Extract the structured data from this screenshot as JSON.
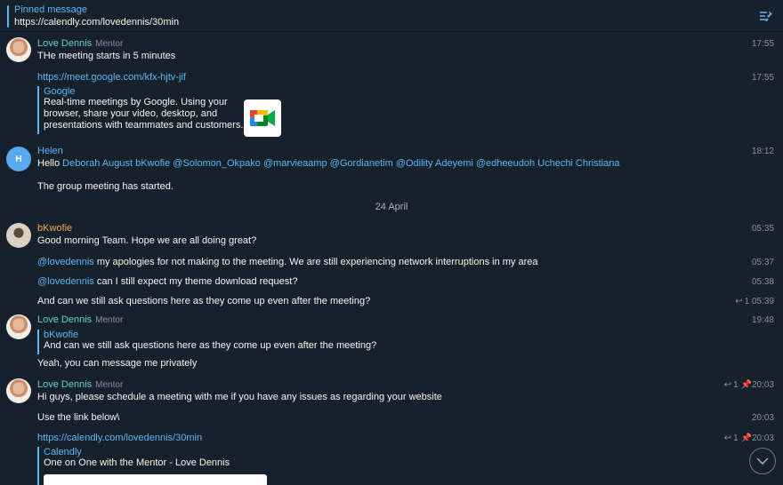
{
  "pinned": {
    "label": "Pinned message",
    "text": "https://calendly.com/lovedennis/30min"
  },
  "messages": {
    "m1": {
      "name": "Love Dennis",
      "role": "Mentor",
      "text": "THe meeting starts in 5 minutes",
      "time": "17:55"
    },
    "m2": {
      "text": "https://meet.google.com/kfx-hjtv-jif",
      "time": "17:55",
      "preview_title": "Google",
      "preview_lines": [
        "Real-time meetings by Google. Using your",
        "browser, share your video, desktop, and",
        "presentations with teammates and customers."
      ]
    },
    "m3": {
      "name": "Helen",
      "avatar_letter": "H",
      "time": "18:12",
      "prefix": "Hello",
      "mentions": "Deborah August bKwofie @Solomon_Okpako @marvieaamp @Gordianetim @Odility Adeyemi @edheeudoh Uchechi Christiana"
    },
    "m4": {
      "text": "The group meeting has started."
    },
    "date": "24 April",
    "m5": {
      "name": "bKwofie",
      "text": "Good morning Team. Hope we are all doing great?",
      "time": "05:35"
    },
    "m6": {
      "mention": "@lovedennis",
      "text": " my apologies for not making to the meeting. We are still experiencing network interruptions in my area",
      "time": "05:37"
    },
    "m7": {
      "mention": "@lovedennis",
      "text": " can I still expect my theme download request?",
      "time": "05:38"
    },
    "m8": {
      "text": "And can we still ask questions here as they come up even after the meeting?",
      "replies": "1",
      "time": "05:39"
    },
    "m9": {
      "name": "Love Dennis",
      "role": "Mentor",
      "time": "19:48",
      "quote_name": "bKwofie",
      "quote_text": "And can we still ask questions here as they come up even after the meeting?",
      "text": "Yeah, you can message me privately"
    },
    "m10": {
      "name": "Love Dennis",
      "role": "Mentor",
      "text": "Hi guys, please schedule a meeting with me if you have any issues as regarding your website",
      "replies": "1",
      "time": "20:03"
    },
    "m11": {
      "text": "Use the link below\\",
      "time": "20:03"
    },
    "m12": {
      "text": "https://calendly.com/lovedennis/30min",
      "replies": "1",
      "time": "20:03",
      "preview_title": "Calendly",
      "preview_text": "One on One with the Mentor - Love Dennis"
    }
  },
  "colors": {
    "background": "#17212b",
    "accent": "#5eb5f7",
    "mentor_name": "#64d2c6",
    "user_name": "#f5a65a"
  }
}
